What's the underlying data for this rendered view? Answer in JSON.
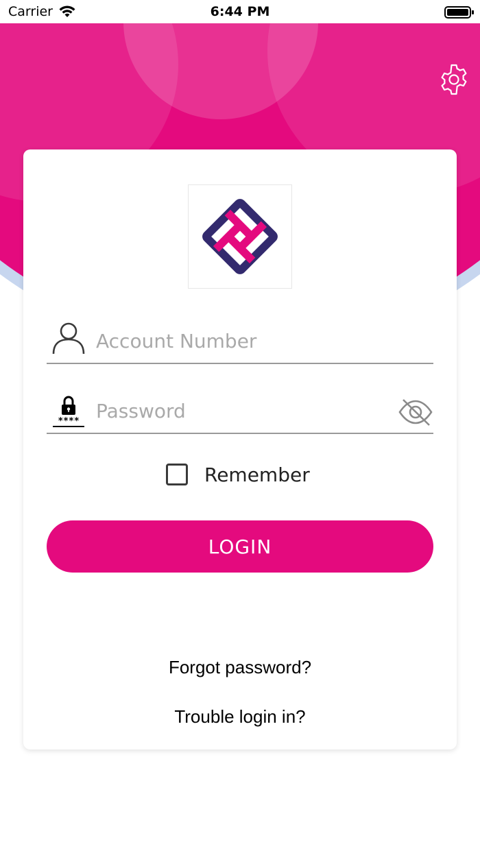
{
  "status_bar": {
    "carrier": "Carrier",
    "time": "6:44 PM"
  },
  "theme": {
    "brand_pink": "#e40a7e",
    "brand_navy": "#332a6e",
    "underline": "#9a9a9a"
  },
  "login_form": {
    "account_placeholder": "Account Number",
    "password_placeholder": "Password",
    "password_icon_mask": "****",
    "remember_label": "Remember",
    "remember_checked": false,
    "login_label": "LOGIN"
  },
  "links": {
    "forgot": "Forgot password?",
    "trouble": "Trouble login in?"
  },
  "icons": {
    "settings": "gear-icon",
    "account": "user-icon",
    "password": "lock-icon",
    "visibility": "eye-slash-icon"
  }
}
